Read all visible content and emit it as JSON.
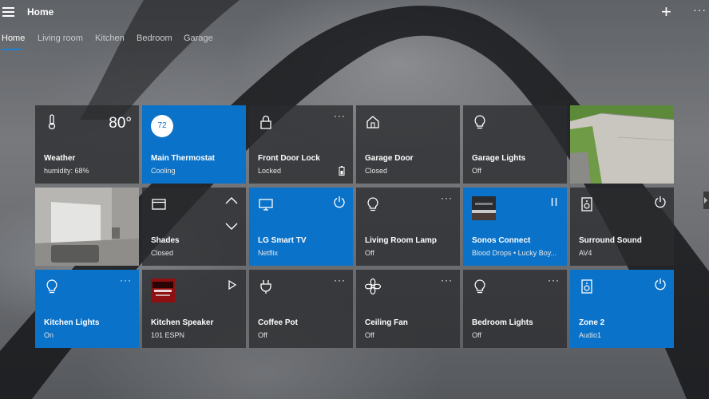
{
  "app": {
    "title": "Home"
  },
  "tabs": [
    {
      "label": "Home",
      "active": true
    },
    {
      "label": "Living room",
      "active": false
    },
    {
      "label": "Kitchen",
      "active": false
    },
    {
      "label": "Bedroom",
      "active": false
    },
    {
      "label": "Garage",
      "active": false
    }
  ],
  "colors": {
    "accent": "#0a72c8",
    "tile_dark": "#2a2b2e",
    "tab_underline": "#1e7fd6"
  },
  "tiles": [
    {
      "name": "Weather",
      "status": "humidity: 68%",
      "value": "80°",
      "icon": "thermometer-icon"
    },
    {
      "name": "Main Thermostat",
      "status": "Cooling",
      "value": "72",
      "style": "blue"
    },
    {
      "name": "Front Door Lock",
      "status": "Locked",
      "icon": "lock-icon",
      "more": "···"
    },
    {
      "name": "Garage Door",
      "status": "Closed",
      "icon": "house-icon"
    },
    {
      "name": "Garage Lights",
      "status": "Off",
      "icon": "lightbulb-icon"
    },
    {
      "name": "",
      "status": "",
      "style": "photo-camera"
    },
    {
      "name": "",
      "status": "",
      "style": "photo-room"
    },
    {
      "name": "Shades",
      "status": "Closed",
      "icon": "window-icon"
    },
    {
      "name": "LG Smart TV",
      "status": "Netflix",
      "icon": "tv-icon",
      "style": "blue"
    },
    {
      "name": "Living Room Lamp",
      "status": "Off",
      "icon": "lightbulb-icon",
      "more": "···"
    },
    {
      "name": "Sonos Connect",
      "status": "Blood Drops • Lucky Boy...",
      "style": "blue"
    },
    {
      "name": "Surround Sound",
      "status": "AV4",
      "icon": "speaker-icon"
    },
    {
      "name": "Kitchen Lights",
      "status": "On",
      "icon": "lightbulb-icon",
      "more": "···",
      "style": "blue"
    },
    {
      "name": "Kitchen Speaker",
      "status": "101 ESPN"
    },
    {
      "name": "Coffee Pot",
      "status": "Off",
      "icon": "plug-icon",
      "more": "···"
    },
    {
      "name": "Ceiling Fan",
      "status": "Off",
      "icon": "fan-icon",
      "more": "···"
    },
    {
      "name": "Bedroom Lights",
      "status": "Off",
      "icon": "lightbulb-icon",
      "more": "···"
    },
    {
      "name": "Zone 2",
      "status": "Audio1",
      "icon": "speaker-icon",
      "style": "blue"
    }
  ]
}
